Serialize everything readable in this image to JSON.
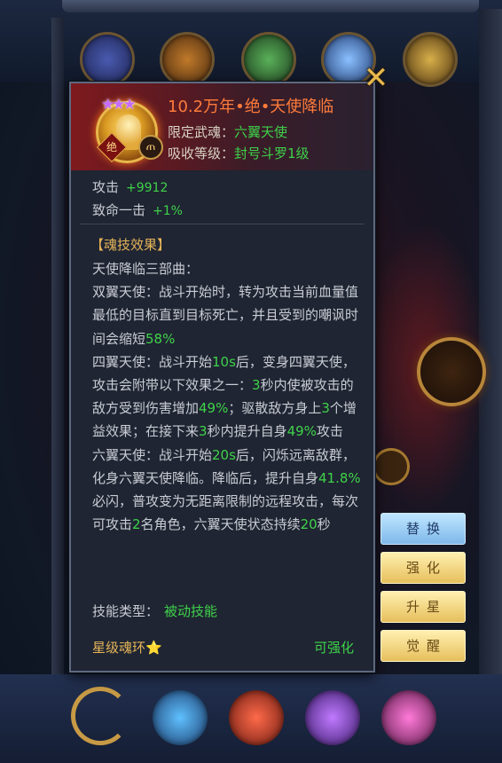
{
  "skill": {
    "title": "10.2万年•绝•天使降临",
    "stars": "★★★",
    "badge_label": "绝",
    "badge_symbol": "ጠ",
    "limited_label": "限定武魂：",
    "limited_value": "六翼天使",
    "absorb_label": "吸收等级：",
    "absorb_value": "封号斗罗1级"
  },
  "stats": [
    {
      "label": "攻击",
      "value": "+9912"
    },
    {
      "label": "致命一击",
      "value": "+1%"
    }
  ],
  "effect": {
    "section_title": "【魂技效果】",
    "segments": [
      {
        "t": "天使降临三部曲：\n双翼天使：战斗开始时，转为攻击当前血量值最低的目标直到目标死亡，并且受到的嘲讽时间会缩短",
        "g": false
      },
      {
        "t": "58%",
        "g": true
      },
      {
        "t": "\n四翼天使：战斗开始",
        "g": false
      },
      {
        "t": "10s",
        "g": true
      },
      {
        "t": "后，变身四翼天使，攻击会附带以下效果之一：",
        "g": false
      },
      {
        "t": "3",
        "g": true
      },
      {
        "t": "秒内使被攻击的敌方受到伤害增加",
        "g": false
      },
      {
        "t": "49%",
        "g": true
      },
      {
        "t": "；驱散敌方身上",
        "g": false
      },
      {
        "t": "3",
        "g": true
      },
      {
        "t": "个增益效果；在接下来",
        "g": false
      },
      {
        "t": "3",
        "g": true
      },
      {
        "t": "秒内提升自身",
        "g": false
      },
      {
        "t": "49%",
        "g": true
      },
      {
        "t": "攻击\n六翼天使：战斗开始",
        "g": false
      },
      {
        "t": "20s",
        "g": true
      },
      {
        "t": "后，闪烁远离敌群，化身六翼天使降临。降临后，提升自身",
        "g": false
      },
      {
        "t": "41.8%",
        "g": true
      },
      {
        "t": "必闪，普攻变为无距离限制的远程攻击，每次可攻击",
        "g": false
      },
      {
        "t": "2",
        "g": true
      },
      {
        "t": "名角色，六翼天使状态持续",
        "g": false
      },
      {
        "t": "20",
        "g": true
      },
      {
        "t": "秒",
        "g": false
      }
    ],
    "type_label": "技能类型：",
    "type_value": "被动技能"
  },
  "footer": {
    "ring_label": "星级魂环",
    "ring_star": "⭐",
    "enhance_label": "可强化"
  },
  "close_glyph": "✕",
  "side_buttons": {
    "replace": "替换",
    "strengthen": "强化",
    "upstar": "升星",
    "awaken": "觉醒"
  }
}
